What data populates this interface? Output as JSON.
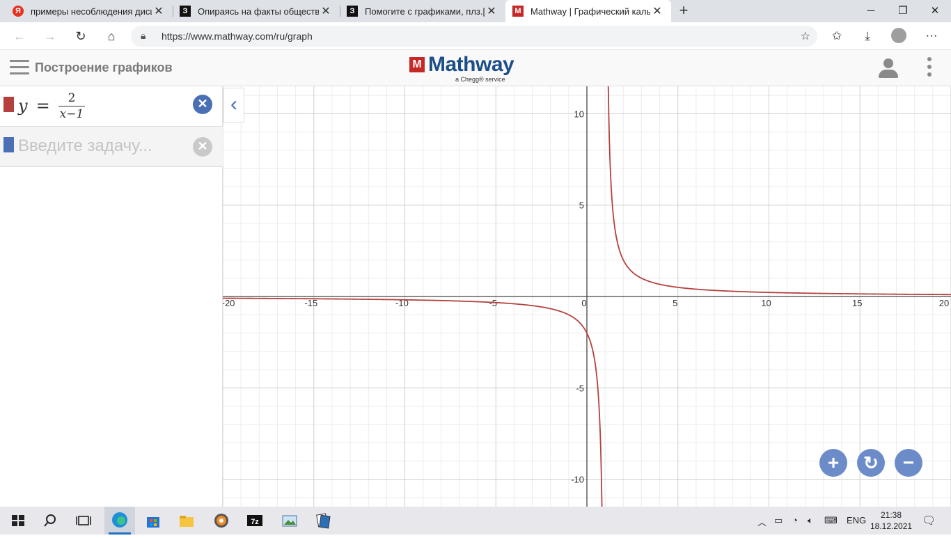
{
  "browser": {
    "tabs": [
      {
        "title": "примеры несоблюдения дисци",
        "favicon": "Я"
      },
      {
        "title": "Опираясь на факты обществен",
        "favicon": "З"
      },
      {
        "title": "Помогите с графиками, плз.[tex",
        "favicon": "З"
      },
      {
        "title": "Mathway | Графический кальку",
        "favicon": "M"
      }
    ],
    "url": "https://www.mathway.com/ru/graph"
  },
  "app": {
    "title": "Построение графиков",
    "logo_text": "Mathway",
    "logo_sub": "a Chegg® service"
  },
  "equations": [
    {
      "lhs": "y",
      "eq": "=",
      "num": "2",
      "den": "x−1",
      "color": "#b5413e"
    },
    {
      "placeholder": "Введите задачу...",
      "color": "#4b6fb5"
    }
  ],
  "chart_data": {
    "type": "line",
    "function": "y = 2/(x-1)",
    "series": [
      {
        "expression": "2/(x-1)",
        "color": "#b5413e"
      }
    ],
    "xlim": [
      -20,
      20
    ],
    "ylim": [
      -11.5,
      11.5
    ],
    "x_ticks": [
      -20,
      -15,
      -10,
      -5,
      0,
      5,
      10,
      15,
      20
    ],
    "y_ticks": [
      -10,
      -5,
      5,
      10
    ],
    "grid": true
  },
  "taskbar": {
    "lang": "ENG",
    "time": "21:38",
    "date": "18.12.2021"
  }
}
